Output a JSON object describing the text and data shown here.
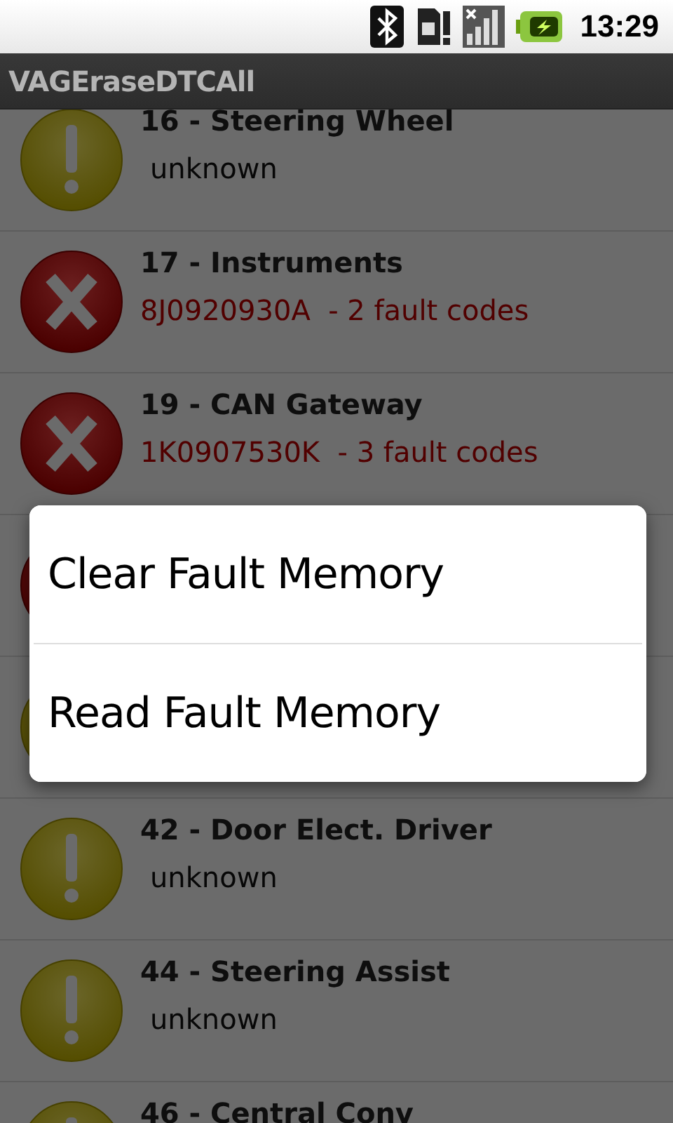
{
  "status_bar": {
    "time": "13:29"
  },
  "window": {
    "title": "VAGEraseDTCAll"
  },
  "list": [
    {
      "kind": "warning",
      "title": "16 - Steering Wheel",
      "detail": "unknown"
    },
    {
      "kind": "error",
      "title": "17 - Instruments",
      "detail": "8J0920930A  - 2 fault codes"
    },
    {
      "kind": "error",
      "title": "19 - CAN Gateway",
      "detail": "1K0907530K  - 3 fault codes"
    },
    {
      "kind": "error"
    },
    {
      "kind": "warning"
    },
    {
      "kind": "warning",
      "title": "42 - Door Elect. Driver",
      "detail": "unknown"
    },
    {
      "kind": "warning",
      "title": "44 - Steering Assist",
      "detail": "unknown"
    },
    {
      "kind": "warning",
      "title": "46 - Central Conv"
    }
  ],
  "dialog": {
    "items": [
      "Clear Fault Memory",
      "Read Fault Memory"
    ]
  }
}
